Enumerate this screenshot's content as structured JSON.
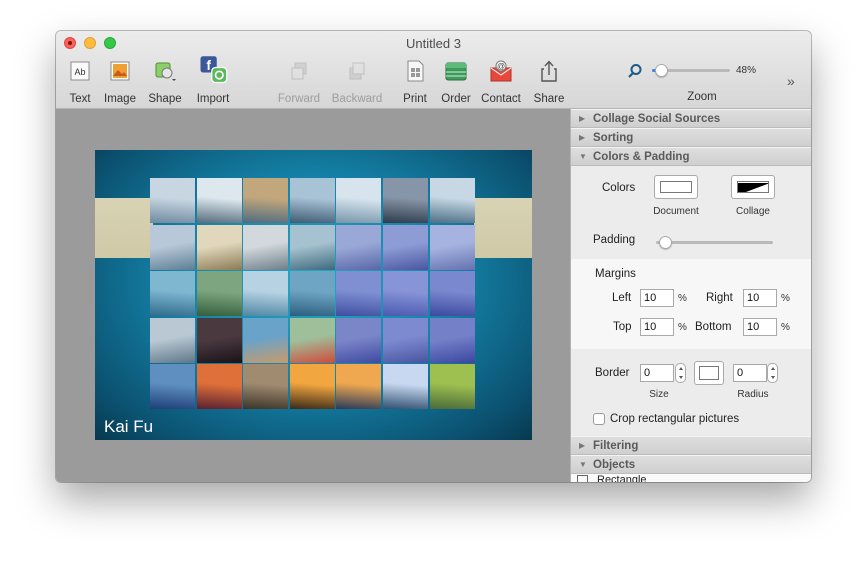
{
  "window": {
    "title": "Untitled 3"
  },
  "toolbar": {
    "items": [
      {
        "label": "Text",
        "icon": "text-icon",
        "enabled": true
      },
      {
        "label": "Image",
        "icon": "image-icon",
        "enabled": true
      },
      {
        "label": "Shape",
        "icon": "shape-icon",
        "enabled": true
      },
      {
        "label": "Import",
        "icon": "import-icon",
        "enabled": true
      },
      {
        "label": "Forward",
        "icon": "forward-icon",
        "enabled": false
      },
      {
        "label": "Backward",
        "icon": "backward-icon",
        "enabled": false
      },
      {
        "label": "Print",
        "icon": "print-icon",
        "enabled": true
      },
      {
        "label": "Order",
        "icon": "order-icon",
        "enabled": true
      },
      {
        "label": "Contact",
        "icon": "contact-icon",
        "enabled": true
      },
      {
        "label": "Share",
        "icon": "share-icon",
        "enabled": true
      }
    ],
    "zoom": {
      "label": "Zoom",
      "value_text": "48%",
      "level": 0.48
    },
    "more_label": "»"
  },
  "collage": {
    "caption": "Kai Fu",
    "rows": 5,
    "cols": 7
  },
  "inspector": {
    "sections": {
      "social_sources": "Collage Social Sources",
      "sorting": "Sorting",
      "colors_padding": "Colors & Padding",
      "filtering": "Filtering",
      "objects": "Objects"
    },
    "colors": {
      "label": "Colors",
      "document_label": "Document",
      "collage_label": "Collage",
      "document_color": "#ffffff",
      "collage_color": "#000000"
    },
    "padding": {
      "label": "Padding",
      "level": 0.08
    },
    "margins": {
      "label": "Margins",
      "left_label": "Left",
      "left": "10",
      "right_label": "Right",
      "right": "10",
      "top_label": "Top",
      "top": "10",
      "bottom_label": "Bottom",
      "bottom": "10",
      "unit": "%"
    },
    "border": {
      "label": "Border",
      "size": "0",
      "size_label": "Size",
      "radius": "0",
      "radius_label": "Radius",
      "color": "#ffffff"
    },
    "crop": {
      "label": "Crop rectangular pictures",
      "checked": false
    },
    "objects_first_item": "Rectangle"
  }
}
